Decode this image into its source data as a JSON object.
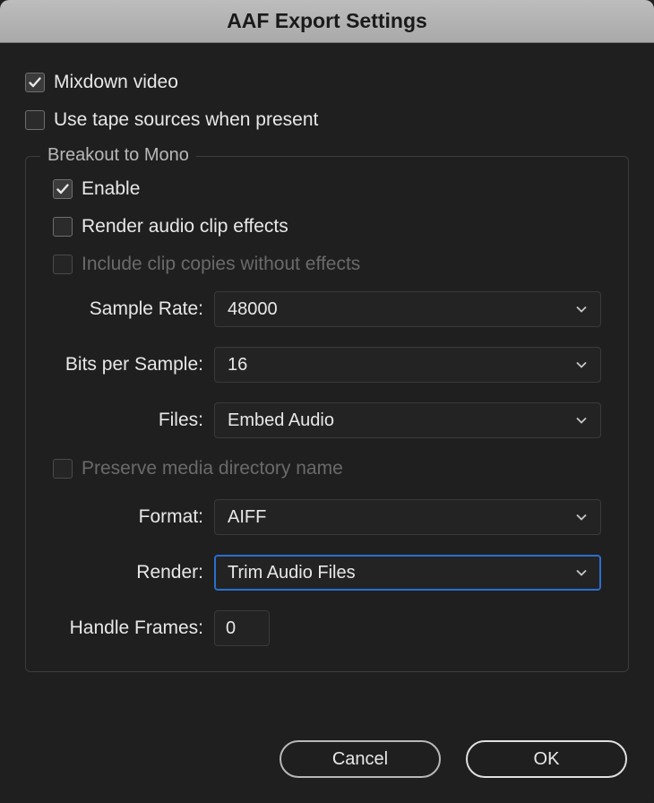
{
  "dialog": {
    "title": "AAF Export Settings"
  },
  "checkboxes": {
    "mixdown_video": {
      "label": "Mixdown video",
      "checked": true
    },
    "use_tape_sources": {
      "label": "Use tape sources when present",
      "checked": false
    }
  },
  "breakout": {
    "legend": "Breakout to Mono",
    "enable": {
      "label": "Enable",
      "checked": true
    },
    "render_effects": {
      "label": "Render audio clip effects",
      "checked": false
    },
    "include_copies": {
      "label": "Include clip copies without effects",
      "checked": false,
      "disabled": true
    },
    "sample_rate": {
      "label": "Sample Rate:",
      "value": "48000"
    },
    "bits_per_sample": {
      "label": "Bits per Sample:",
      "value": "16"
    },
    "files": {
      "label": "Files:",
      "value": "Embed Audio"
    },
    "preserve_media": {
      "label": "Preserve media directory name",
      "checked": false,
      "disabled": true
    },
    "format": {
      "label": "Format:",
      "value": "AIFF"
    },
    "render": {
      "label": "Render:",
      "value": "Trim Audio Files",
      "focused": true
    },
    "handle_frames": {
      "label": "Handle Frames:",
      "value": "0"
    }
  },
  "buttons": {
    "cancel": "Cancel",
    "ok": "OK"
  }
}
